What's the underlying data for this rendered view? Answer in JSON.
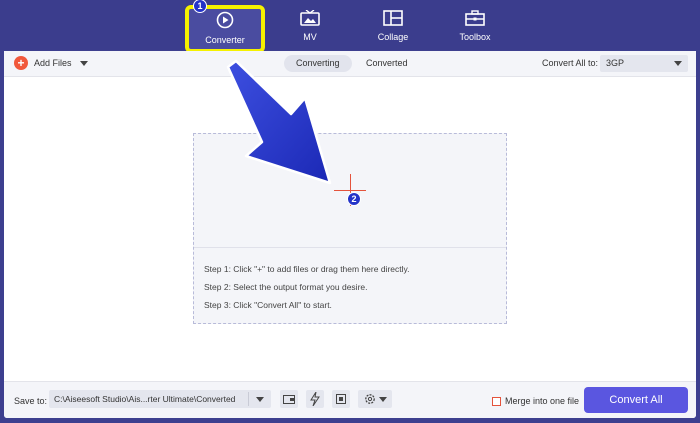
{
  "nav": {
    "items": [
      {
        "label": "Converter",
        "icon": "converter-icon"
      },
      {
        "label": "MV",
        "icon": "tv-icon"
      },
      {
        "label": "Collage",
        "icon": "collage-icon"
      },
      {
        "label": "Toolbox",
        "icon": "toolbox-icon"
      }
    ]
  },
  "annotations": {
    "badge_1": "1",
    "badge_2": "2"
  },
  "toolbar": {
    "add_files": "Add Files",
    "tabs": [
      "Converting",
      "Converted"
    ],
    "convert_all_to": "Convert All to:",
    "format": "3GP"
  },
  "dropzone": {
    "steps": [
      "Step 1: Click \"+\" to add files or drag them here directly.",
      "Step 2: Select the output format you desire.",
      "Step 3: Click \"Convert All\" to start."
    ]
  },
  "bottom": {
    "save_to": "Save to:",
    "path": "C:\\Aiseesoft Studio\\Ais...rter Ultimate\\Converted",
    "merge": "Merge into one file",
    "convert_all": "Convert All"
  },
  "colors": {
    "nav_bg": "#3b3d8d",
    "highlight": "#f5f100",
    "accent": "#5a56e0",
    "plus": "#f1583b",
    "arrow": "#2433c8"
  }
}
